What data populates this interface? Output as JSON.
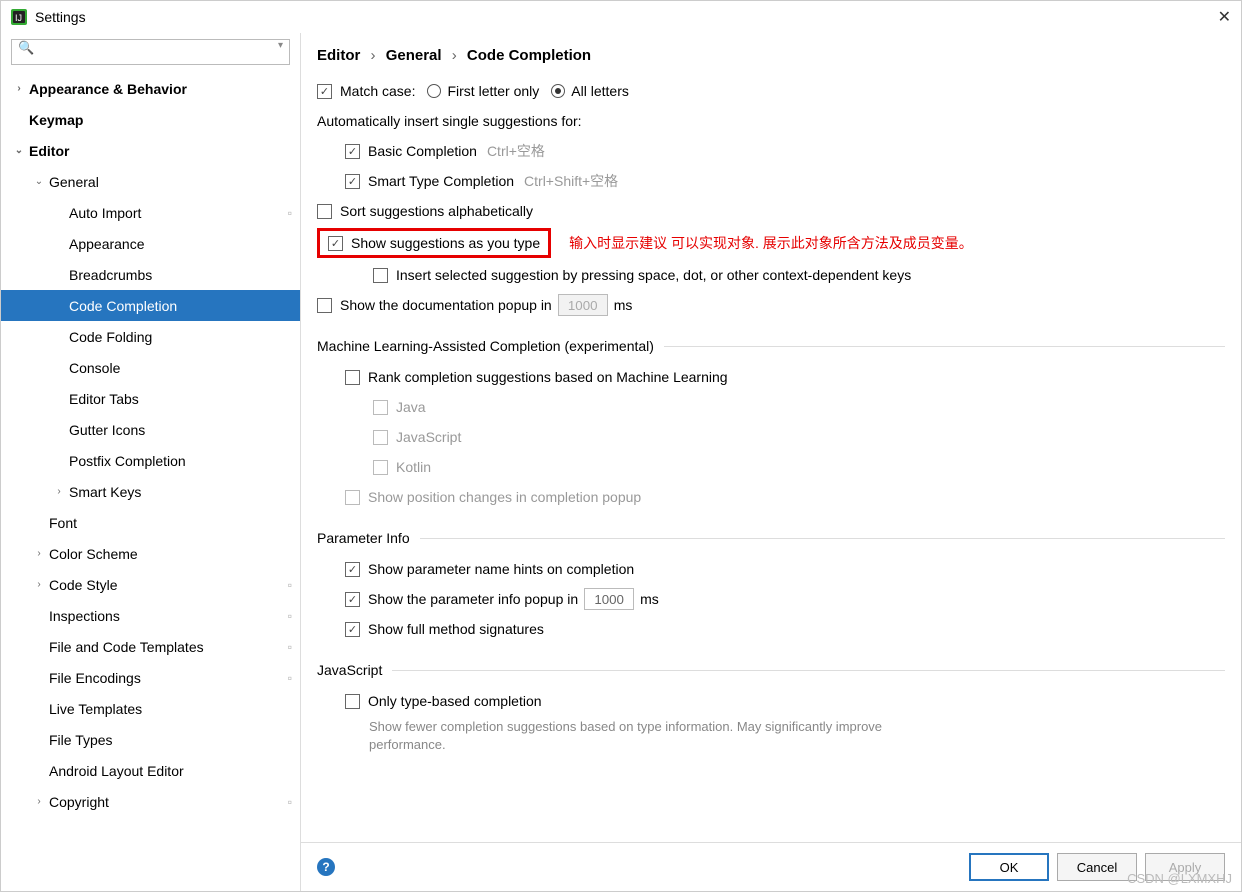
{
  "window": {
    "title": "Settings"
  },
  "breadcrumb": [
    "Editor",
    "General",
    "Code Completion"
  ],
  "sidebar": {
    "search_placeholder": "",
    "items": [
      {
        "label": "Appearance & Behavior",
        "depth": 0,
        "arrow": "›",
        "bold": true
      },
      {
        "label": "Keymap",
        "depth": 0,
        "arrow": "",
        "bold": true
      },
      {
        "label": "Editor",
        "depth": 0,
        "arrow": "⌄",
        "bold": true
      },
      {
        "label": "General",
        "depth": 1,
        "arrow": "⌄",
        "bold": false
      },
      {
        "label": "Auto Import",
        "depth": 2,
        "arrow": "",
        "page": true
      },
      {
        "label": "Appearance",
        "depth": 2,
        "arrow": ""
      },
      {
        "label": "Breadcrumbs",
        "depth": 2,
        "arrow": ""
      },
      {
        "label": "Code Completion",
        "depth": 2,
        "arrow": "",
        "selected": true
      },
      {
        "label": "Code Folding",
        "depth": 2,
        "arrow": ""
      },
      {
        "label": "Console",
        "depth": 2,
        "arrow": ""
      },
      {
        "label": "Editor Tabs",
        "depth": 2,
        "arrow": ""
      },
      {
        "label": "Gutter Icons",
        "depth": 2,
        "arrow": ""
      },
      {
        "label": "Postfix Completion",
        "depth": 2,
        "arrow": ""
      },
      {
        "label": "Smart Keys",
        "depth": 2,
        "arrow": "›"
      },
      {
        "label": "Font",
        "depth": 1,
        "arrow": ""
      },
      {
        "label": "Color Scheme",
        "depth": 1,
        "arrow": "›"
      },
      {
        "label": "Code Style",
        "depth": 1,
        "arrow": "›",
        "page": true
      },
      {
        "label": "Inspections",
        "depth": 1,
        "arrow": "",
        "page": true
      },
      {
        "label": "File and Code Templates",
        "depth": 1,
        "arrow": "",
        "page": true
      },
      {
        "label": "File Encodings",
        "depth": 1,
        "arrow": "",
        "page": true
      },
      {
        "label": "Live Templates",
        "depth": 1,
        "arrow": ""
      },
      {
        "label": "File Types",
        "depth": 1,
        "arrow": ""
      },
      {
        "label": "Android Layout Editor",
        "depth": 1,
        "arrow": ""
      },
      {
        "label": "Copyright",
        "depth": 1,
        "arrow": "›",
        "page": true
      }
    ]
  },
  "settings": {
    "match_case_label": "Match case:",
    "first_letter": "First letter only",
    "all_letters": "All letters",
    "auto_insert": "Automatically insert single suggestions for:",
    "basic_completion": "Basic Completion",
    "basic_shortcut": "Ctrl+空格",
    "smart_completion": "Smart Type Completion",
    "smart_shortcut": "Ctrl+Shift+空格",
    "sort_alpha": "Sort suggestions alphabetically",
    "show_suggestions": "Show suggestions as you type",
    "annotation": "输入时显示建议  可以实现对象. 展示此对象所含方法及成员变量。",
    "insert_selected": "Insert selected suggestion by pressing space, dot, or other context-dependent keys",
    "show_doc": "Show the documentation popup in",
    "show_doc_value": "1000",
    "ms": "ms",
    "ml_section": "Machine Learning-Assisted Completion (experimental)",
    "rank_ml": "Rank completion suggestions based on Machine Learning",
    "ml_langs": [
      "Java",
      "JavaScript",
      "Kotlin"
    ],
    "show_pos": "Show position changes in completion popup",
    "param_section": "Parameter Info",
    "show_param_hints": "Show parameter name hints on completion",
    "show_param_popup": "Show the parameter info popup in",
    "show_param_value": "1000",
    "show_full_sig": "Show full method signatures",
    "js_section": "JavaScript",
    "only_type": "Only type-based completion",
    "only_type_hint": "Show fewer completion suggestions based on type information. May significantly improve performance."
  },
  "footer": {
    "ok": "OK",
    "cancel": "Cancel",
    "apply": "Apply"
  },
  "watermark": "CSDN @LXMXHJ"
}
